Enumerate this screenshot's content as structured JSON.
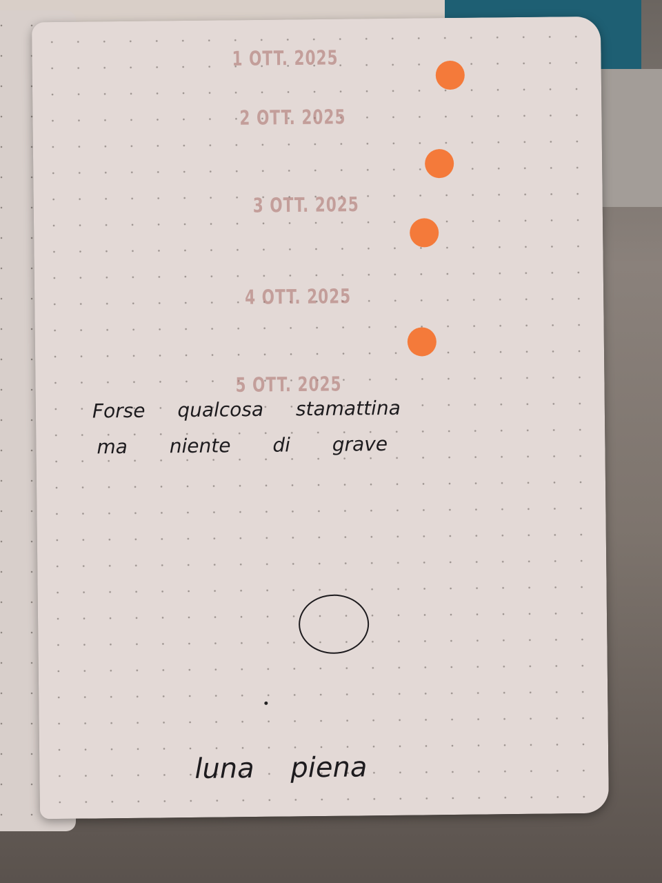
{
  "stamps": [
    "1 OTT. 2025",
    "2 OTT. 2025",
    "3 OTT. 2025",
    "4 OTT. 2025",
    "5 OTT. 2025"
  ],
  "note": {
    "line1": "Forse qualcosa stamattina",
    "line2": "ma niente di grave"
  },
  "caption": "luna piena",
  "colors": {
    "dot": "#f47a3a",
    "paper": "#e3d9d6",
    "ink": "#1d1b1e"
  }
}
